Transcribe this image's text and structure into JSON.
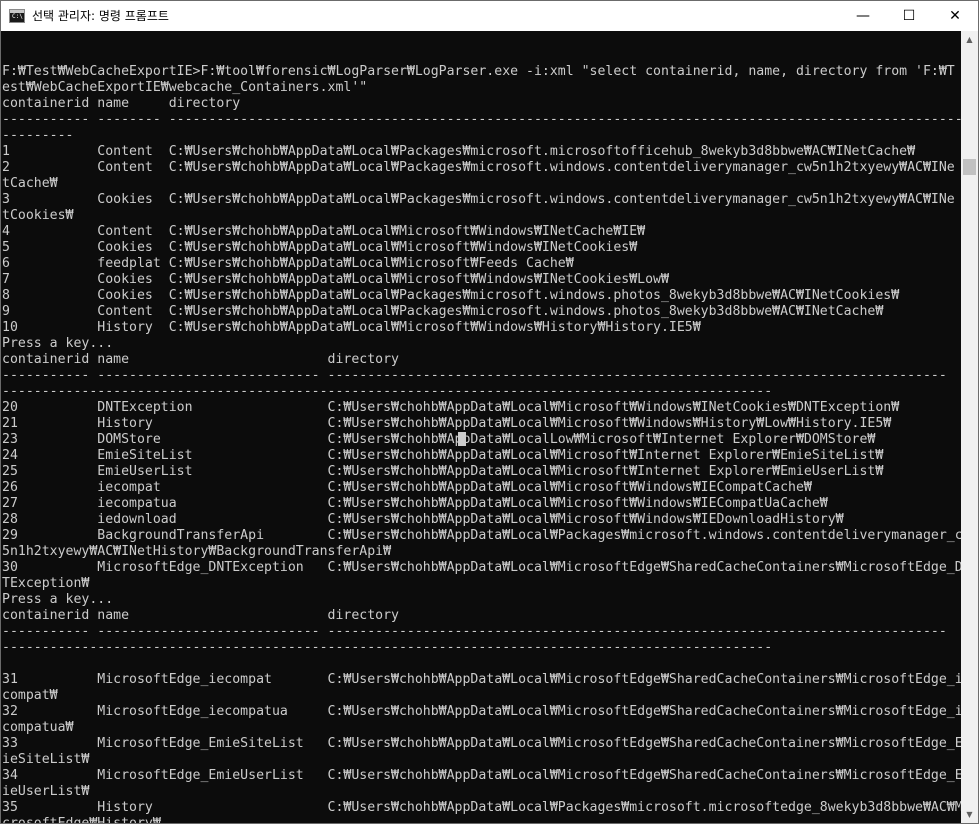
{
  "window": {
    "title": "선택 관리자: 명령 프롬프트",
    "icon_label": "C:\\",
    "minimize_glyph": "—",
    "maximize_glyph": "☐",
    "close_glyph": "✕"
  },
  "console": {
    "lines": [
      "F:₩Test₩WebCacheExportIE>F:₩tool₩forensic₩LogParser₩LogParser.exe -i:xml \"select containerid, name, directory from 'F:₩T",
      "est₩WebCacheExportIE₩webcache_Containers.xml'\"",
      "containerid name     directory",
      "----------- -------- ----------------------------------------------------------------------------------------------------",
      "---------",
      "1           Content  C:₩Users₩chohb₩AppData₩Local₩Packages₩microsoft.microsoftofficehub_8wekyb3d8bbwe₩AC₩INetCache₩",
      "2           Content  C:₩Users₩chohb₩AppData₩Local₩Packages₩microsoft.windows.contentdeliverymanager_cw5n1h2txyewy₩AC₩INe",
      "tCache₩",
      "3           Cookies  C:₩Users₩chohb₩AppData₩Local₩Packages₩microsoft.windows.contentdeliverymanager_cw5n1h2txyewy₩AC₩INe",
      "tCookies₩",
      "4           Content  C:₩Users₩chohb₩AppData₩Local₩Microsoft₩Windows₩INetCache₩IE₩",
      "5           Cookies  C:₩Users₩chohb₩AppData₩Local₩Microsoft₩Windows₩INetCookies₩",
      "6           feedplat C:₩Users₩chohb₩AppData₩Local₩Microsoft₩Feeds Cache₩",
      "7           Cookies  C:₩Users₩chohb₩AppData₩Local₩Microsoft₩Windows₩INetCookies₩Low₩",
      "8           Cookies  C:₩Users₩chohb₩AppData₩Local₩Packages₩microsoft.windows.photos_8wekyb3d8bbwe₩AC₩INetCookies₩",
      "9           Content  C:₩Users₩chohb₩AppData₩Local₩Packages₩microsoft.windows.photos_8wekyb3d8bbwe₩AC₩INetCache₩",
      "10          History  C:₩Users₩chohb₩AppData₩Local₩Microsoft₩Windows₩History₩History.IE5₩",
      "Press a key...",
      "containerid name                         directory",
      "----------- ---------------------------- ------------------------------------------------------------------------------",
      "-------------------------------------------------------------------------------------------------",
      "20          DNTException                 C:₩Users₩chohb₩AppData₩Local₩Microsoft₩Windows₩INetCookies₩DNTException₩",
      "21          History                      C:₩Users₩chohb₩AppData₩Local₩Microsoft₩Windows₩History₩Low₩History.IE5₩",
      "23          DOMStore                     C:₩Users₩chohb₩AppData₩LocalLow₩Microsoft₩Internet Explorer₩DOMStore₩",
      "24          EmieSiteList                 C:₩Users₩chohb₩AppData₩Local₩Microsoft₩Internet Explorer₩EmieSiteList₩",
      "25          EmieUserList                 C:₩Users₩chohb₩AppData₩Local₩Microsoft₩Internet Explorer₩EmieUserList₩",
      "26          iecompat                     C:₩Users₩chohb₩AppData₩Local₩Microsoft₩Windows₩IECompatCache₩",
      "27          iecompatua                   C:₩Users₩chohb₩AppData₩Local₩Microsoft₩Windows₩IECompatUaCache₩",
      "28          iedownload                   C:₩Users₩chohb₩AppData₩Local₩Microsoft₩Windows₩IEDownloadHistory₩",
      "29          BackgroundTransferApi        C:₩Users₩chohb₩AppData₩Local₩Packages₩microsoft.windows.contentdeliverymanager_cw",
      "5n1h2txyewy₩AC₩INetHistory₩BackgroundTransferApi₩",
      "30          MicrosoftEdge_DNTException   C:₩Users₩chohb₩AppData₩Local₩MicrosoftEdge₩SharedCacheContainers₩MicrosoftEdge_DN",
      "TException₩",
      "Press a key...",
      "containerid name                         directory",
      "----------- ---------------------------- ------------------------------------------------------------------------------",
      "-------------------------------------------------------------------------------------------------",
      "",
      "31          MicrosoftEdge_iecompat       C:₩Users₩chohb₩AppData₩Local₩MicrosoftEdge₩SharedCacheContainers₩MicrosoftEdge_ie",
      "compat₩",
      "32          MicrosoftEdge_iecompatua     C:₩Users₩chohb₩AppData₩Local₩MicrosoftEdge₩SharedCacheContainers₩MicrosoftEdge_ie",
      "compatua₩",
      "33          MicrosoftEdge_EmieSiteList   C:₩Users₩chohb₩AppData₩Local₩MicrosoftEdge₩SharedCacheContainers₩MicrosoftEdge_Em",
      "ieSiteList₩",
      "34          MicrosoftEdge_EmieUserList   C:₩Users₩chohb₩AppData₩Local₩MicrosoftEdge₩SharedCacheContainers₩MicrosoftEdge_Em",
      "ieUserList₩",
      "35          History                      C:₩Users₩chohb₩AppData₩Local₩Packages₩microsoft.microsoftedge_8wekyb3d8bbwe₩AC₩Mi",
      "crosoftEdge₩History₩"
    ]
  },
  "colors": {
    "console_background": "#0c0c0c",
    "console_text": "#cccccc",
    "titlebar_background": "#ffffff",
    "scrollbar_track": "#f0f0f0",
    "scrollbar_thumb": "#c1c1c1"
  },
  "icons": {
    "app": "command-prompt-icon",
    "minimize": "minimize-icon",
    "maximize": "maximize-icon",
    "close": "close-icon",
    "scroll_up": "scroll-up-arrow-icon",
    "scroll_down": "scroll-down-arrow-icon"
  }
}
